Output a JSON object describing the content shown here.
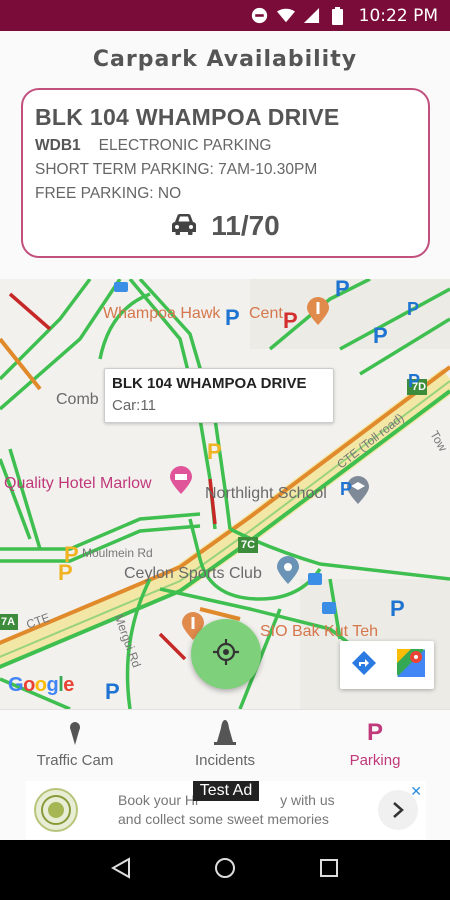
{
  "status_bar": {
    "time": "10:22 PM"
  },
  "header": {
    "title": "Carpark Availability"
  },
  "card": {
    "name": "BLK 104 WHAMPOA DRIVE",
    "code": "WDB1",
    "parking_type": "ELECTRONIC PARKING",
    "short_term": "SHORT TERM PARKING: 7AM-10.30PM",
    "free_parking": "FREE PARKING: NO",
    "availability": "11/70",
    "icon": "car-icon"
  },
  "map": {
    "labels": {
      "whampoa_hawker": "Whampoa Hawk",
      "centre_frag": "Cent",
      "comb": "Comb",
      "quality_hotel": "Quality Hotel Marlow",
      "northlight": "Northlight School",
      "moulmein": "Moulmein Rd",
      "ceylon": "Ceylon Sports Club",
      "sio": "SIO Bak Kut Teh",
      "mergui": "Mergui Rd",
      "cte": "CTE",
      "cte_toll": "CTE (Toll road)",
      "towner": "Tow",
      "shield_7d": "7D",
      "shield_7c": "7C",
      "shield_7a": "7A",
      "google": "Google"
    },
    "tooltip": {
      "title": "BLK 104 WHAMPOA DRIVE",
      "subtitle": "Car:11"
    },
    "colors": {
      "road_green": "#3fbf4f",
      "road_orange": "#e08a2c",
      "road_red": "#c62828",
      "expressway": "#f3e7a6"
    }
  },
  "bottom_nav": {
    "items": [
      {
        "label": "Traffic Cam",
        "icon": "location-pin-icon"
      },
      {
        "label": "Incidents",
        "icon": "cone-icon"
      },
      {
        "label": "Parking",
        "icon": "parking-icon",
        "active": true
      }
    ],
    "active_color": "#c0397a"
  },
  "ad": {
    "tag": "Test Ad",
    "line1": "Book your Hi",
    "line1b": "y with us",
    "line2": "and collect some sweet memories"
  }
}
